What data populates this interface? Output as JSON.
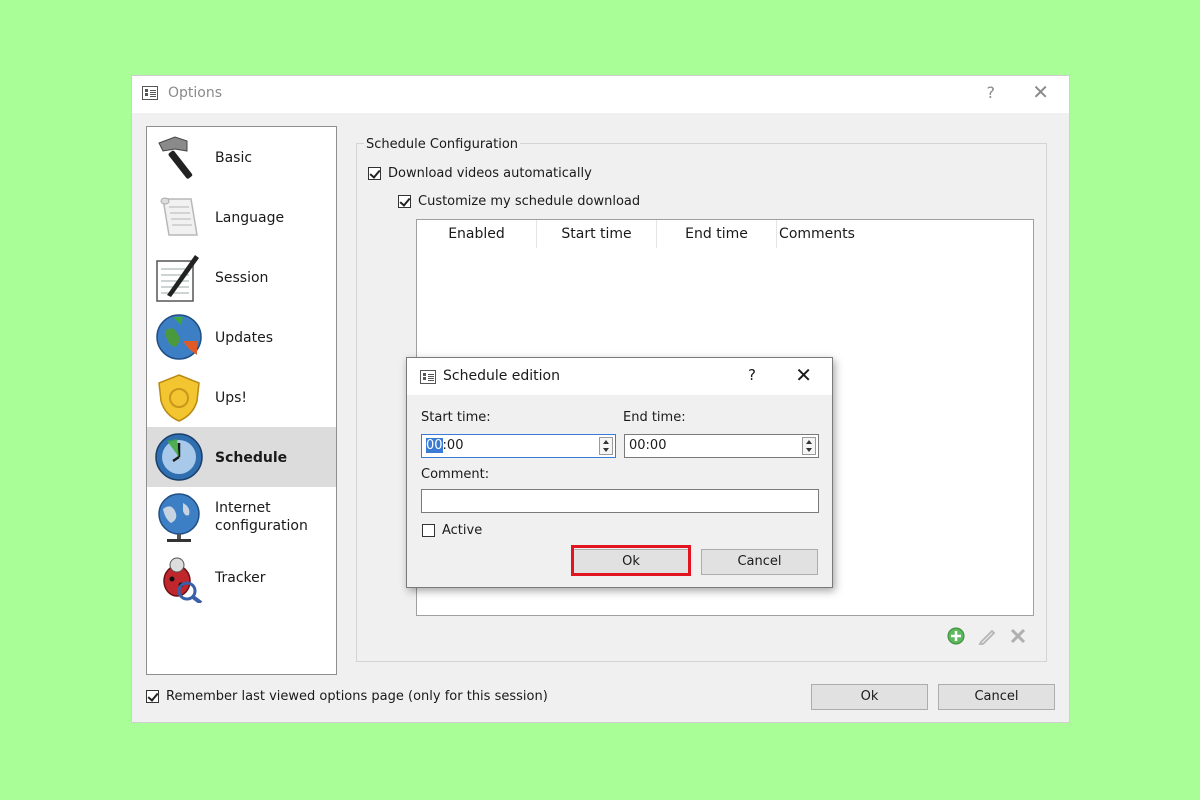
{
  "window": {
    "title": "Options",
    "help_glyph": "?",
    "close_glyph": "✕"
  },
  "sidebar": {
    "items": [
      {
        "label": "Basic",
        "icon": "hammer-icon"
      },
      {
        "label": "Language",
        "icon": "scroll-icon"
      },
      {
        "label": "Session",
        "icon": "notepad-pen-icon"
      },
      {
        "label": "Updates",
        "icon": "globe-update-icon"
      },
      {
        "label": "Ups!",
        "icon": "shield-icon"
      },
      {
        "label": "Schedule",
        "icon": "clock-icon",
        "selected": true
      },
      {
        "label": "Internet configuration",
        "label_line1": "Internet",
        "label_line2": "configuration",
        "icon": "globe-network-icon"
      },
      {
        "label": "Tracker",
        "icon": "bug-magnifier-icon"
      }
    ]
  },
  "schedule": {
    "group_title": "Schedule Configuration",
    "download_auto_label": "Download videos automatically",
    "download_auto_checked": true,
    "customize_label": "Customize my schedule download",
    "customize_checked": true,
    "columns": [
      "Enabled",
      "Start time",
      "End time",
      "Comments"
    ],
    "tools": [
      "add-icon",
      "edit-icon",
      "delete-icon"
    ]
  },
  "footer": {
    "remember_label": "Remember last viewed options page (only for this session)",
    "remember_checked": true,
    "ok_label": "Ok",
    "cancel_label": "Cancel"
  },
  "dialog": {
    "title": "Schedule edition",
    "help_glyph": "?",
    "close_glyph": "✕",
    "start_label": "Start time:",
    "start_value_selected": "00",
    "start_value_rest": ":00",
    "end_label": "End time:",
    "end_value": "00:00",
    "comment_label": "Comment:",
    "comment_value": "",
    "active_label": "Active",
    "active_checked": false,
    "ok_label": "Ok",
    "cancel_label": "Cancel"
  },
  "colors": {
    "background": "#a9fe97",
    "highlight": "#e2141f",
    "selection": "#3a7bd5"
  }
}
